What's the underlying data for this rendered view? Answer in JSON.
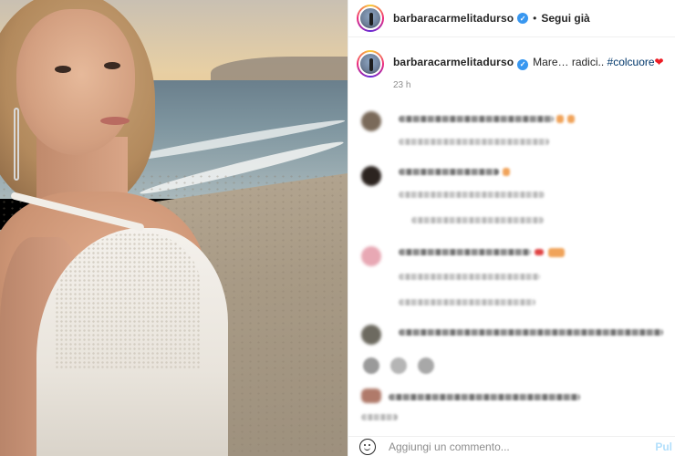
{
  "post": {
    "author": {
      "username": "barbaracarmelitadurso",
      "verified_glyph": "✓"
    },
    "header": {
      "separator": "•",
      "follow_label": "Segui già"
    },
    "caption": {
      "text": "Mare… radici.. ",
      "hashtag": "#colcuore",
      "heart": "❤"
    },
    "time_ago": "23 h",
    "image": {
      "description_icon": "photo-beach-selfie",
      "colors": {
        "sky": "#e7cfa4",
        "sea": "#7f96a0",
        "sand": "#a89a85",
        "dress": "#f4f1ec"
      }
    }
  },
  "add_comment": {
    "placeholder": "Aggiungi un commento...",
    "publish_label": "Pul",
    "emoji_icon": "smiley-icon"
  },
  "colors": {
    "text": "#262626",
    "muted": "#8e8e8e",
    "link": "#00376b",
    "verified": "#3897f0",
    "publish_disabled": "#b2dffc"
  }
}
